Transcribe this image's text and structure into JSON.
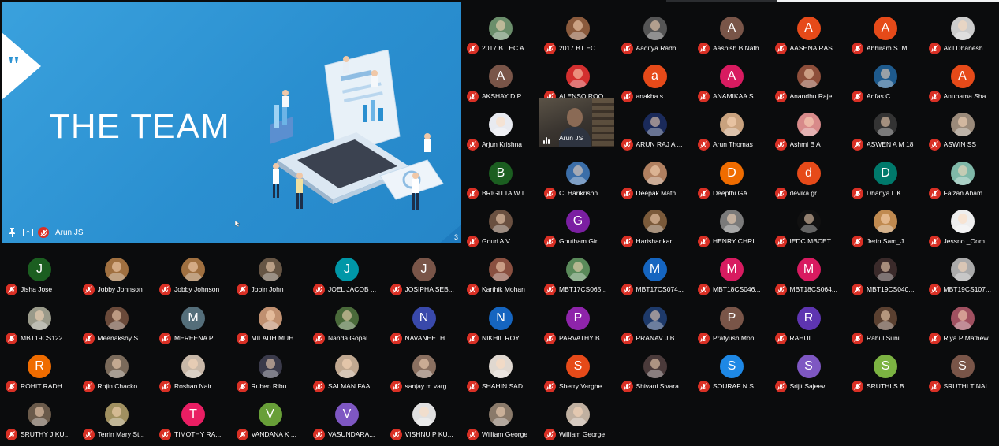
{
  "presentation": {
    "slide_title": "THE TEAM",
    "slide_number": "3",
    "presenter_name": "Arun JS",
    "colors": {
      "background": "#2c93d3",
      "accent": "#ffffff"
    }
  },
  "participants": [
    {
      "name": "2017 BT EC A...",
      "avatar": {
        "type": "photo",
        "color": "#6b8e6b"
      }
    },
    {
      "name": "2017 BT EC ...",
      "avatar": {
        "type": "photo",
        "color": "#8a5a3c"
      }
    },
    {
      "name": "Aaditya Radh...",
      "avatar": {
        "type": "photo",
        "color": "#555555"
      }
    },
    {
      "name": "Aashish B Nath",
      "avatar": {
        "type": "letter",
        "letter": "A",
        "color": "#795548"
      }
    },
    {
      "name": "AASHNA RAS...",
      "avatar": {
        "type": "letter",
        "letter": "A",
        "color": "#e64a19"
      }
    },
    {
      "name": "Abhiram S. M...",
      "avatar": {
        "type": "letter",
        "letter": "A",
        "color": "#e64a19"
      }
    },
    {
      "name": "Akil Dhanesh",
      "avatar": {
        "type": "photo",
        "color": "#cccccc"
      }
    },
    {
      "name": "AKSHAY DIP...",
      "avatar": {
        "type": "letter",
        "letter": "A",
        "color": "#795548"
      }
    },
    {
      "name": "ALENSO ROO...",
      "avatar": {
        "type": "photo",
        "color": "#d32f2f"
      }
    },
    {
      "name": "anakha s",
      "avatar": {
        "type": "letter",
        "letter": "a",
        "color": "#e64a19"
      }
    },
    {
      "name": "ANAMIKAA S ...",
      "avatar": {
        "type": "letter",
        "letter": "A",
        "color": "#d81b60"
      }
    },
    {
      "name": "Anandhu Raje...",
      "avatar": {
        "type": "photo",
        "color": "#8d4e3a"
      }
    },
    {
      "name": "Anfas C",
      "avatar": {
        "type": "photo",
        "color": "#1e5a8c"
      }
    },
    {
      "name": "Anupama Sha...",
      "avatar": {
        "type": "letter",
        "letter": "A",
        "color": "#e64a19"
      }
    },
    {
      "name": "Arjun Krishna",
      "avatar": {
        "type": "photo",
        "color": "#e8eaf0"
      }
    },
    {
      "name": "Arun JS",
      "avatar": {
        "type": "video",
        "color": "#3a3530"
      }
    },
    {
      "name": "ARUN RAJ A ...",
      "avatar": {
        "type": "photo",
        "color": "#1a2a5a"
      }
    },
    {
      "name": "Arun Thomas",
      "avatar": {
        "type": "photo",
        "color": "#c9a27e"
      }
    },
    {
      "name": "Ashmi B A",
      "avatar": {
        "type": "photo",
        "color": "#d88a8a"
      }
    },
    {
      "name": "ASWEN A M 18",
      "avatar": {
        "type": "photo",
        "color": "#333333"
      }
    },
    {
      "name": "ASWIN SS",
      "avatar": {
        "type": "photo",
        "color": "#9a8a7a"
      }
    },
    {
      "name": "BRIGITTA W L...",
      "avatar": {
        "type": "letter",
        "letter": "B",
        "color": "#1b5e20"
      }
    },
    {
      "name": "C. Harikrishn...",
      "avatar": {
        "type": "photo",
        "color": "#3b6ea8"
      }
    },
    {
      "name": "Deepak Math...",
      "avatar": {
        "type": "photo",
        "color": "#b08060"
      }
    },
    {
      "name": "Deepthi GA",
      "avatar": {
        "type": "letter",
        "letter": "D",
        "color": "#ef6c00"
      }
    },
    {
      "name": "devika gr",
      "avatar": {
        "type": "letter",
        "letter": "d",
        "color": "#e64a19"
      }
    },
    {
      "name": "Dhanya L K",
      "avatar": {
        "type": "letter",
        "letter": "D",
        "color": "#00796b"
      }
    },
    {
      "name": "Faizan Aham...",
      "avatar": {
        "type": "photo",
        "color": "#7fb8a8"
      }
    },
    {
      "name": "Gouri A V",
      "avatar": {
        "type": "photo",
        "color": "#6a5040"
      }
    },
    {
      "name": "Goutham Giri...",
      "avatar": {
        "type": "letter",
        "letter": "G",
        "color": "#7b1fa2"
      }
    },
    {
      "name": "Harishankar ...",
      "avatar": {
        "type": "photo",
        "color": "#7a5a3a"
      }
    },
    {
      "name": "HENRY CHRI...",
      "avatar": {
        "type": "photo",
        "color": "#7a7a7a"
      }
    },
    {
      "name": "IEDC MBCET",
      "avatar": {
        "type": "photo",
        "color": "#111111"
      }
    },
    {
      "name": "Jerin Sam_J",
      "avatar": {
        "type": "photo",
        "color": "#c08a50"
      }
    },
    {
      "name": "Jessno _Oom...",
      "avatar": {
        "type": "photo",
        "color": "#eeeeee"
      }
    },
    {
      "name": "Jisha Jose",
      "avatar": {
        "type": "letter",
        "letter": "J",
        "color": "#1b5e20"
      }
    },
    {
      "name": "Jobby Johnson",
      "avatar": {
        "type": "photo",
        "color": "#a07040"
      }
    },
    {
      "name": "Jobby Johnson",
      "avatar": {
        "type": "photo",
        "color": "#a07040"
      }
    },
    {
      "name": "Jobin John",
      "avatar": {
        "type": "photo",
        "color": "#665544"
      }
    },
    {
      "name": "JOEL JACOB ...",
      "avatar": {
        "type": "letter",
        "letter": "J",
        "color": "#0097a7"
      }
    },
    {
      "name": "JOSIPHA SEB...",
      "avatar": {
        "type": "letter",
        "letter": "J",
        "color": "#795548"
      }
    },
    {
      "name": "Karthik Mohan",
      "avatar": {
        "type": "photo",
        "color": "#8a5040"
      }
    },
    {
      "name": "MBT17CS065...",
      "avatar": {
        "type": "photo",
        "color": "#5a8a5a"
      }
    },
    {
      "name": "MBT17CS074...",
      "avatar": {
        "type": "letter",
        "letter": "M",
        "color": "#1565c0"
      }
    },
    {
      "name": "MBT18CS046...",
      "avatar": {
        "type": "letter",
        "letter": "M",
        "color": "#d81b60"
      }
    },
    {
      "name": "MBT18CS064...",
      "avatar": {
        "type": "letter",
        "letter": "M",
        "color": "#d81b60"
      }
    },
    {
      "name": "MBT19CS040...",
      "avatar": {
        "type": "photo",
        "color": "#3a2a2a"
      }
    },
    {
      "name": "MBT19CS107...",
      "avatar": {
        "type": "photo",
        "color": "#aaaaaa"
      }
    },
    {
      "name": "MBT19CS122...",
      "avatar": {
        "type": "photo",
        "color": "#9a9a8a"
      }
    },
    {
      "name": "Meenakshy S...",
      "avatar": {
        "type": "photo",
        "color": "#6a4a3a"
      }
    },
    {
      "name": "MEREENA P ...",
      "avatar": {
        "type": "letter",
        "letter": "M",
        "color": "#546e7a"
      }
    },
    {
      "name": "MILADH MUH...",
      "avatar": {
        "type": "photo",
        "color": "#c09070"
      }
    },
    {
      "name": "Nanda Gopal",
      "avatar": {
        "type": "photo",
        "color": "#4a6a3a"
      }
    },
    {
      "name": "NAVANEETH ...",
      "avatar": {
        "type": "letter",
        "letter": "N",
        "color": "#3949ab"
      }
    },
    {
      "name": "NIKHIL ROY ...",
      "avatar": {
        "type": "letter",
        "letter": "N",
        "color": "#1565c0"
      }
    },
    {
      "name": "PARVATHY B ...",
      "avatar": {
        "type": "letter",
        "letter": "P",
        "color": "#8e24aa"
      }
    },
    {
      "name": "PRANAV J B ...",
      "avatar": {
        "type": "photo",
        "color": "#1e3a6a"
      }
    },
    {
      "name": "Pratyush Mon...",
      "avatar": {
        "type": "letter",
        "letter": "P",
        "color": "#795548"
      }
    },
    {
      "name": "RAHUL",
      "avatar": {
        "type": "letter",
        "letter": "R",
        "color": "#5e35b1"
      }
    },
    {
      "name": "Rahul Sunil",
      "avatar": {
        "type": "photo",
        "color": "#5a4030"
      }
    },
    {
      "name": "Riya P Mathew",
      "avatar": {
        "type": "photo",
        "color": "#a05060"
      }
    },
    {
      "name": "ROHIT RADH...",
      "avatar": {
        "type": "letter",
        "letter": "R",
        "color": "#ef6c00"
      }
    },
    {
      "name": "Rojin Chacko ...",
      "avatar": {
        "type": "photo",
        "color": "#7a6a5a"
      }
    },
    {
      "name": "Roshan Nair",
      "avatar": {
        "type": "photo",
        "color": "#c8b8a8"
      }
    },
    {
      "name": "Ruben Ribu",
      "avatar": {
        "type": "photo",
        "color": "#3a3a4a"
      }
    },
    {
      "name": "SALMAN FAA...",
      "avatar": {
        "type": "photo",
        "color": "#c0a890"
      }
    },
    {
      "name": "sanjay m varg...",
      "avatar": {
        "type": "photo",
        "color": "#8a7060"
      }
    },
    {
      "name": "SHAHIN SAD...",
      "avatar": {
        "type": "photo",
        "color": "#e0d8d0"
      }
    },
    {
      "name": "Sherry Varghe...",
      "avatar": {
        "type": "letter",
        "letter": "S",
        "color": "#e64a19"
      }
    },
    {
      "name": "Shivani Sivara...",
      "avatar": {
        "type": "photo",
        "color": "#4a3a3a"
      }
    },
    {
      "name": "SOURAF N S ...",
      "avatar": {
        "type": "letter",
        "letter": "S",
        "color": "#1e88e5"
      }
    },
    {
      "name": "Srijit Sajeev ...",
      "avatar": {
        "type": "letter",
        "letter": "S",
        "color": "#7e57c2"
      }
    },
    {
      "name": "SRUTHI S B ...",
      "avatar": {
        "type": "letter",
        "letter": "S",
        "color": "#7cb342"
      }
    },
    {
      "name": "SRUTHI T NAI...",
      "avatar": {
        "type": "letter",
        "letter": "S",
        "color": "#795548"
      }
    },
    {
      "name": "SRUTHY J KU...",
      "avatar": {
        "type": "photo",
        "color": "#6a5a4a"
      }
    },
    {
      "name": "Terrin Mary St...",
      "avatar": {
        "type": "photo",
        "color": "#a09060"
      }
    },
    {
      "name": "TIMOTHY RA...",
      "avatar": {
        "type": "letter",
        "letter": "T",
        "color": "#e91e63"
      }
    },
    {
      "name": "VANDANA K ...",
      "avatar": {
        "type": "letter",
        "letter": "V",
        "color": "#689f38"
      }
    },
    {
      "name": "VASUNDARA...",
      "avatar": {
        "type": "letter",
        "letter": "V",
        "color": "#7e57c2"
      }
    },
    {
      "name": "VISHNU P KU...",
      "avatar": {
        "type": "photo",
        "color": "#e0e0e0"
      }
    },
    {
      "name": "William George",
      "avatar": {
        "type": "photo",
        "color": "#8a7a6a"
      }
    },
    {
      "name": "William George",
      "avatar": {
        "type": "photo",
        "color": "#c0b0a0"
      }
    }
  ]
}
